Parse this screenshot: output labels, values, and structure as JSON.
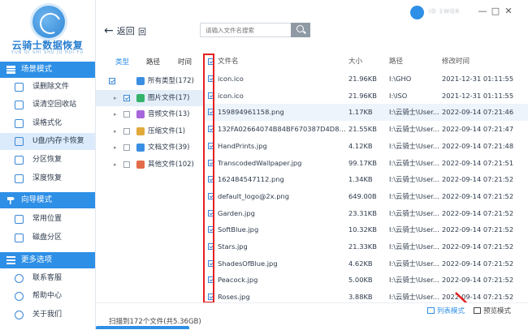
{
  "app": {
    "title": "云骑士数据恢复",
    "subtitle": "YUN QI SHI SHU JU HUI FU"
  },
  "sidebar": {
    "sections": [
      {
        "label": "场景模式",
        "icon": "scene-icon",
        "items": [
          {
            "label": "误删除文件"
          },
          {
            "label": "误清空回收站"
          },
          {
            "label": "误格式化"
          },
          {
            "label": "U盘/内存卡恢复",
            "active": true
          },
          {
            "label": "分区恢复"
          },
          {
            "label": "深度恢复"
          }
        ]
      },
      {
        "label": "向导模式",
        "icon": "wizard-icon",
        "items": [
          {
            "label": "常用位置"
          },
          {
            "label": "磁盘分区"
          }
        ]
      },
      {
        "label": "更多选项",
        "icon": "more-icon",
        "items": [
          {
            "label": "联系客服"
          },
          {
            "label": "帮助中心"
          },
          {
            "label": "关于我们"
          }
        ]
      }
    ]
  },
  "toolbar": {
    "back_label": "返回",
    "home_label": "回",
    "search_placeholder": "请输入文件名搜索",
    "user_name": "ID 1WQ8",
    "window_controls": [
      "—",
      "□",
      "✕"
    ]
  },
  "tree": {
    "tabs": [
      "类型",
      "路径",
      "时间"
    ],
    "nodes": [
      {
        "label": "所有类型(172)",
        "checked": true,
        "expand": "▾",
        "icon_color": "#3a8fe2"
      },
      {
        "label": "图片文件(17)",
        "checked": true,
        "expand": "▸",
        "icon_color": "#35b36b",
        "selected": true
      },
      {
        "label": "音频文件(13)",
        "checked": false,
        "expand": "▸",
        "icon_color": "#a766dc"
      },
      {
        "label": "压缩文件(1)",
        "checked": false,
        "expand": "▸",
        "icon_color": "#e2a93b"
      },
      {
        "label": "文档文件(39)",
        "checked": false,
        "expand": "▸",
        "icon_color": "#3a8fe2"
      },
      {
        "label": "其他文件(102)",
        "checked": false,
        "expand": "▸",
        "icon_color": "#e26c4a"
      }
    ]
  },
  "table": {
    "headers": {
      "name": "文件名",
      "size": "大小",
      "path": "路径",
      "modified": "修改时间"
    },
    "rows": [
      {
        "name": "icon.ico",
        "size": "21.96KB",
        "path": "I:\\GHO",
        "modified": "2021-12-31 01:11:55"
      },
      {
        "name": "icon.ico",
        "size": "21.96KB",
        "path": "I:\\ISO",
        "modified": "2021-12-31 01:11:55"
      },
      {
        "name": "159894961158.png",
        "size": "1.17KB",
        "path": "I:\\云骑士\\User...",
        "modified": "2022-09-14 07:21:46"
      },
      {
        "name": "132FA02664074B84BF670387D4D85E9B...",
        "size": "21.55KB",
        "path": "I:\\云骑士\\User...",
        "modified": "2022-09-14 07:21:47"
      },
      {
        "name": "HandPrints.jpg",
        "size": "4.12KB",
        "path": "I:\\云骑士\\User...",
        "modified": "2022-09-14 07:21:48"
      },
      {
        "name": "TranscodedWallpaper.jpg",
        "size": "99.17KB",
        "path": "I:\\云骑士\\User...",
        "modified": "2022-09-14 07:21:51"
      },
      {
        "name": "162484547112.png",
        "size": "1.34KB",
        "path": "I:\\云骑士\\User...",
        "modified": "2022-09-14 07:21:52"
      },
      {
        "name": "default_logo@2x.png",
        "size": "649.00B",
        "path": "I:\\云骑士\\User...",
        "modified": "2022-09-14 07:21:52"
      },
      {
        "name": "Garden.jpg",
        "size": "23.31KB",
        "path": "I:\\云骑士\\User...",
        "modified": "2022-09-14 07:21:52"
      },
      {
        "name": "SoftBlue.jpg",
        "size": "10.32KB",
        "path": "I:\\云骑士\\User...",
        "modified": "2022-09-14 07:21:52"
      },
      {
        "name": "Stars.jpg",
        "size": "21.33KB",
        "path": "I:\\云骑士\\User...",
        "modified": "2022-09-14 07:21:52"
      },
      {
        "name": "ShadesOfBlue.jpg",
        "size": "4.62KB",
        "path": "I:\\云骑士\\User...",
        "modified": "2022-09-14 07:21:52"
      },
      {
        "name": "Peacock.jpg",
        "size": "5.00KB",
        "path": "I:\\云骑士\\User...",
        "modified": "2022-09-14 07:21:52"
      },
      {
        "name": "Roses.jpg",
        "size": "3.88KB",
        "path": "I:\\云骑士\\User...",
        "modified": "2022-09-14 07:21:52"
      }
    ]
  },
  "footer": {
    "count_text": "扫描到172个文件(共5.36GB)",
    "list_mode": "列表模式",
    "preview_mode": "预览模式"
  },
  "colors": {
    "accent": "#2e8fe6",
    "selected_row": "#edf4fb",
    "annotation": "#e52020"
  }
}
